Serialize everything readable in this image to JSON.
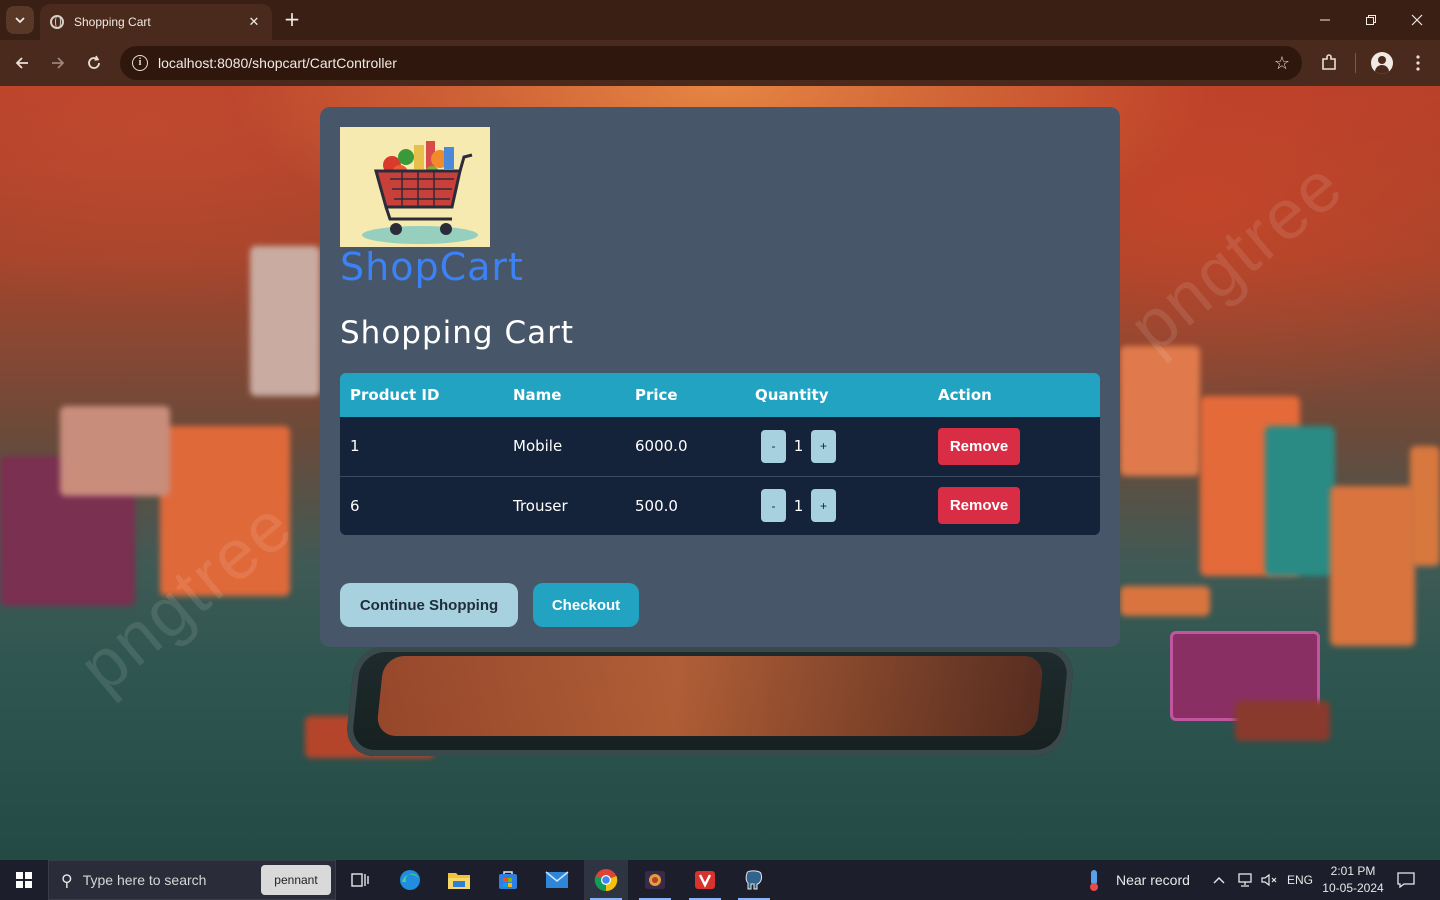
{
  "browser": {
    "tab_title": "Shopping Cart",
    "url": "localhost:8080/shopcart/CartController"
  },
  "page": {
    "brand": "ShopCart",
    "title": "Shopping Cart",
    "table": {
      "headers": [
        "Product ID",
        "Name",
        "Price",
        "Quantity",
        "Action"
      ],
      "rows": [
        {
          "id": "1",
          "name": "Mobile",
          "price": "6000.0",
          "quantity": "1"
        },
        {
          "id": "6",
          "name": "Trouser",
          "price": "500.0",
          "quantity": "1"
        }
      ],
      "decrement_label": "-",
      "increment_label": "+",
      "remove_label": "Remove"
    },
    "continue_label": "Continue Shopping",
    "checkout_label": "Checkout"
  },
  "taskbar": {
    "search_placeholder": "Type here to search",
    "search_badge": "pennant",
    "weather": "Near record",
    "language": "ENG",
    "time": "2:01 PM",
    "date": "10-05-2024"
  },
  "colors": {
    "card": "#475669",
    "table_header": "#23a3c2",
    "table_body": "#14223a",
    "remove": "#d92d45",
    "brand": "#3b82f6"
  }
}
